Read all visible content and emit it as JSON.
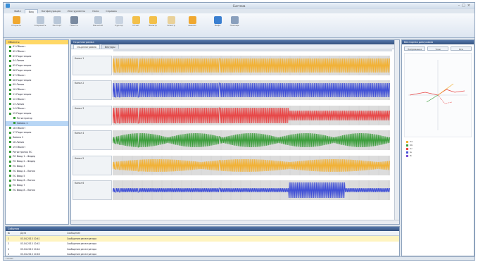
{
  "app": {
    "title": "Система"
  },
  "ribbon": {
    "tabs": [
      {
        "label": "Файл"
      },
      {
        "label": "Вид"
      },
      {
        "label": "Конфигурация"
      },
      {
        "label": "Инструменты"
      },
      {
        "label": "Окно"
      },
      {
        "label": "Справка"
      }
    ],
    "buttons": [
      {
        "label": "Открыть",
        "icon": "folder-icon",
        "color": "#f0a830"
      },
      {
        "label": "Сохранить",
        "icon": "save-icon",
        "color": "#b9c7d8"
      },
      {
        "label": "Экспорт",
        "icon": "export-icon",
        "color": "#b9c7d8"
      },
      {
        "label": "Печать",
        "icon": "printer-icon",
        "color": "#7a8aa0"
      },
      {
        "label": "Масштаб",
        "icon": "zoom-icon",
        "color": "#b9c7d8"
      },
      {
        "label": "Курсор",
        "icon": "cursor-icon",
        "color": "#c9d4e2"
      },
      {
        "label": "Отчёт",
        "icon": "report-icon",
        "color": "#f3c04a"
      },
      {
        "label": "Фильтр",
        "icon": "filter-icon",
        "color": "#f3c04a"
      },
      {
        "label": "Спектр",
        "icon": "spectrum-icon",
        "color": "#e9d19a"
      },
      {
        "label": "Анализ",
        "icon": "analysis-icon",
        "color": "#f0a830"
      },
      {
        "label": "Инфо",
        "icon": "info-icon",
        "color": "#3a7fd0"
      },
      {
        "label": "Помощь",
        "icon": "help-icon",
        "color": "#8aa0bd"
      }
    ]
  },
  "tree": {
    "title": "Объекты",
    "items": [
      {
        "label": "01 Объект"
      },
      {
        "label": "02 Объект"
      },
      {
        "label": "03 Подстанция"
      },
      {
        "label": "04 Линия"
      },
      {
        "label": "05 Подстанция"
      },
      {
        "label": "06 Подстанция"
      },
      {
        "label": "07 Объект"
      },
      {
        "label": "08 Подстанция"
      },
      {
        "label": "09 Линия"
      },
      {
        "label": "10 Объект"
      },
      {
        "label": "11 Подстанция"
      },
      {
        "label": "12 Объект"
      },
      {
        "label": "13 Линия"
      },
      {
        "label": "14 Объект"
      },
      {
        "label": "15 Подстанция"
      },
      {
        "label": "Регистратор"
      },
      {
        "label": "Запись 1"
      },
      {
        "label": "16 Объект"
      },
      {
        "label": "17 Подстанция"
      },
      {
        "label": "Запись 2"
      },
      {
        "label": "18 Линия"
      },
      {
        "label": "19 Объект"
      },
      {
        "label": "Регистратор ПС"
      },
      {
        "label": "ПС Ввод 1 - Фидер"
      },
      {
        "label": "ПС Ввод 2 - Фидер"
      },
      {
        "label": "ПС Ввод 3"
      },
      {
        "label": "ПС Ввод 4 - Линия"
      },
      {
        "label": "ПС Ввод 5"
      },
      {
        "label": "ПС Ввод 6 - Линия"
      },
      {
        "label": "ПС Ввод 7"
      },
      {
        "label": "ПС Ввод 8 - Линия"
      }
    ]
  },
  "oscillogram": {
    "title": "Осциллограмма",
    "tabs": [
      {
        "label": "Осциллограмма"
      },
      {
        "label": "Векторы"
      }
    ],
    "channels": [
      {
        "name": "Канал 1",
        "color": "#f2b134"
      },
      {
        "name": "Канал 2",
        "color": "#3f4fd6"
      },
      {
        "name": "Канал 3",
        "color": "#e84646"
      },
      {
        "name": "Канал 4",
        "color": "#3a9d3a"
      },
      {
        "name": "Канал 5",
        "color": "#f2b134"
      },
      {
        "name": "Канал 6",
        "color": "#3f4fd6"
      }
    ]
  },
  "vector_panel": {
    "title": "Векторная диаграмма",
    "buttons": [
      {
        "label": "Напряжения"
      },
      {
        "label": "Токи"
      },
      {
        "label": "Все"
      }
    ],
    "legend": [
      {
        "label": "Ua",
        "color": "#f2b134"
      },
      {
        "label": "Ub",
        "color": "#3a9d3a"
      },
      {
        "label": "Uc",
        "color": "#e84646"
      },
      {
        "label": "Ia",
        "color": "#3f4fd6"
      },
      {
        "label": "Ib",
        "color": "#7a4fd6"
      }
    ]
  },
  "events": {
    "title": "События",
    "columns": [
      "№",
      "Дата",
      "Сообщение"
    ],
    "rows": [
      {
        "n": "1",
        "date": "03.04.2013 10:41",
        "msg": "Сообщение регистратора"
      },
      {
        "n": "2",
        "date": "03.04.2013 10:42",
        "msg": "Сообщение регистратора"
      },
      {
        "n": "3",
        "date": "03.04.2013 10:44",
        "msg": "Сообщение регистратора"
      },
      {
        "n": "4",
        "date": "03.04.2013 10:46",
        "msg": "Сообщение регистратора"
      },
      {
        "n": "5",
        "date": "03.04.2013 10:48",
        "msg": "Сообщение регистратора"
      }
    ]
  },
  "status": {
    "text": "Готово"
  }
}
